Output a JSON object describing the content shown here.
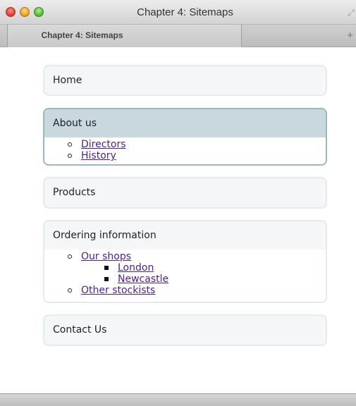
{
  "window": {
    "title": "Chapter 4: Sitemaps"
  },
  "tabs": [
    {
      "label": "Chapter 4: Sitemaps"
    }
  ],
  "new_tab": "+",
  "sitemap": {
    "home": "Home",
    "about": {
      "label": "About us",
      "children": [
        "Directors",
        "History"
      ]
    },
    "products": "Products",
    "ordering": {
      "label": "Ordering information",
      "shops": "Our shops",
      "shop_children": [
        "London",
        "Newcastle"
      ],
      "stockists": "Other stockists"
    },
    "contact": "Contact Us"
  },
  "colors": {
    "link": "#4b1f94",
    "active_header": "#c9d8dc",
    "active_border": "#9bb6bd",
    "box_bg": "#f5f6f8"
  }
}
